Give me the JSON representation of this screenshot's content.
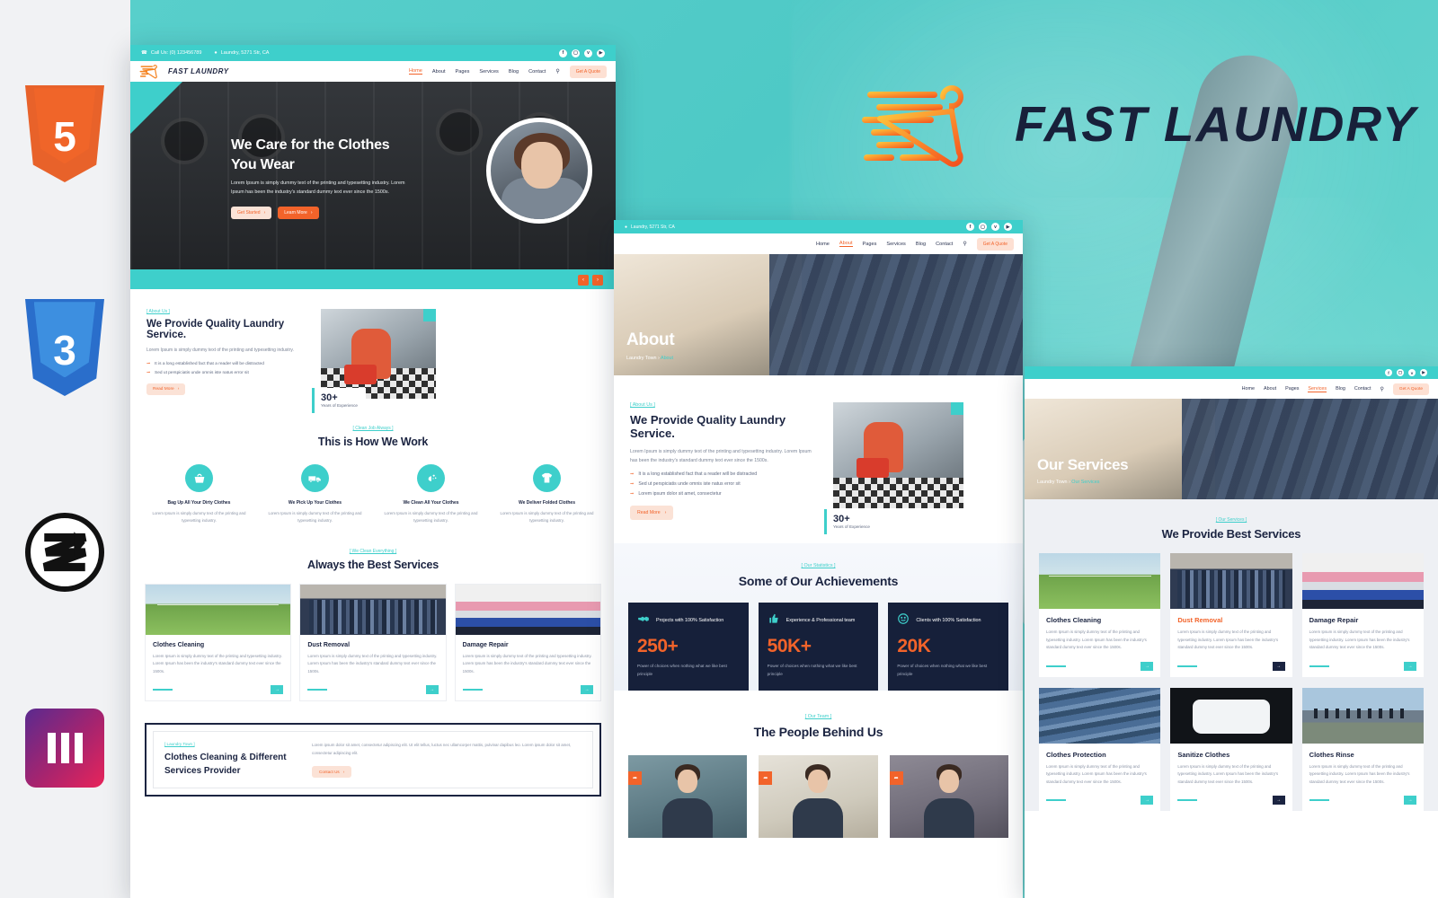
{
  "brand": {
    "name": "FAST LAUNDRY",
    "logo_icon": "hanger-speed-icon"
  },
  "banner": {
    "title": "FAST LAUNDRY"
  },
  "tech_badges": [
    {
      "name": "html5-badge",
      "label": "5"
    },
    {
      "name": "css3-badge",
      "label": "3"
    },
    {
      "name": "zend-badge",
      "label": ""
    },
    {
      "name": "elementor-badge",
      "label": ""
    }
  ],
  "topbar": {
    "phone_icon": "phone-icon",
    "phone": "Call Us: (0) 123456789",
    "location_icon": "map-pin-icon",
    "location": "Laundry, 5271 Str, CA",
    "socials": [
      {
        "name": "facebook-icon",
        "glyph": "f"
      },
      {
        "name": "instagram-icon",
        "glyph": "▢"
      },
      {
        "name": "twitter-icon",
        "glyph": "ᴠ"
      },
      {
        "name": "youtube-icon",
        "glyph": "▶"
      }
    ]
  },
  "nav": {
    "items": [
      "Home",
      "About",
      "Pages",
      "Services",
      "Blog",
      "Contact"
    ],
    "search_icon": "search-icon",
    "quote_label": "Get A Quote",
    "quote_arrow": "›",
    "active_home": "Home",
    "active_about": "About",
    "active_services": "Services"
  },
  "home": {
    "hero": {
      "title": "We Care for the Clothes You Wear",
      "paragraph": "Lorem Ipsum is simply dummy text of the printing and typesetting industry. Lorem Ipsum has been the industry's standard dummy text ever since the 1500s.",
      "btn_primary": "Get Started",
      "btn_secondary": "Learn More",
      "prev_icon": "chevron-left-icon",
      "next_icon": "chevron-right-icon"
    },
    "about": {
      "eyebrow": "[ About Us ]",
      "title": "We Provide Quality Laundry Service.",
      "paragraph": "Lorem Ipsum is simply dummy text of the printing and typesetting industry.",
      "bullets": [
        "It is a long established fact that a reader will be distracted",
        "Sed ut perspiciatis unde omnis iste natus error sit"
      ],
      "read_more": "Read More",
      "exp_number": "30+",
      "exp_label": "Years of Experience"
    },
    "work": {
      "eyebrow": "[ Clean Job Always ]",
      "title": "This is How We Work",
      "steps": [
        {
          "icon": "basket-icon",
          "title": "Bag Up All Your Dirty Clothes",
          "text": "Lorem Ipsum is simply dummy text of the printing and typesetting industry."
        },
        {
          "icon": "truck-icon",
          "title": "We Pick Up Your Clothes",
          "text": "Lorem Ipsum is simply dummy text of the printing and typesetting industry."
        },
        {
          "icon": "washing-hand-icon",
          "title": "We Clean All Your Clothes",
          "text": "Lorem Ipsum is simply dummy text of the printing and typesetting industry."
        },
        {
          "icon": "tshirt-icon",
          "title": "We Deliver Folded Clothes",
          "text": "Lorem Ipsum is simply dummy text of the printing and typesetting industry."
        }
      ]
    },
    "services": {
      "eyebrow": "[ We Clean Everything ]",
      "title": "Always the Best Services",
      "cards": [
        {
          "title": "Clothes Cleaning",
          "text": "Lorem Ipsum is simply dummy text of the printing and typesetting industry. Lorem Ipsum has been the industry's standard dummy text ever since the 1500s."
        },
        {
          "title": "Dust Removal",
          "text": "Lorem Ipsum is simply dummy text of the printing and typesetting industry. Lorem Ipsum has been the industry's standard dummy text ever since the 1500s."
        },
        {
          "title": "Damage Repair",
          "text": "Lorem Ipsum is simply dummy text of the printing and typesetting industry. Lorem Ipsum has been the industry's standard dummy text ever since the 1500s."
        }
      ]
    },
    "cta": {
      "eyebrow": "[ Laundry Town ]",
      "title": "Clothes Cleaning & Different Services Provider",
      "text": "Lorem ipsum dolor sit amet, consectetur adipiscing elit. Ut elit tellus, luctus nec ullamcorper mattis, pulvinar dapibus leo. Lorem ipsum dolor sit amet, consectetur adipiscing elit.",
      "button": "Contact Us"
    }
  },
  "about_page": {
    "hero_title": "About",
    "crumb_root": "Laundry Town",
    "crumb_sep": "›",
    "crumb_current": "About",
    "about": {
      "eyebrow": "[ About Us ]",
      "title": "We Provide Quality Laundry Service.",
      "paragraph": "Lorem Ipsum is simply dummy text of the printing and typesetting industry. Lorem Ipsum has been the industry's standard dummy text ever since the 1500s.",
      "bullets": [
        "It is a long established fact that a reader will be distracted",
        "Sed ut perspiciatis unde omnis iste natus error sit",
        "Lorem ipsum dolor sit amet, consectetur"
      ],
      "read_more": "Read More",
      "exp_number": "30+",
      "exp_label": "Years of Experience"
    },
    "stats": {
      "eyebrow": "[ Our Statistics ]",
      "title": "Some of Our Achievements",
      "items": [
        {
          "icon": "handshake-icon",
          "label": "Projects with 100% Satisfaction",
          "value": "250+",
          "sub": "Power of choices when nothing what we like best principle"
        },
        {
          "icon": "thumbs-up-icon",
          "label": "Experience & Professional team",
          "value": "50K+",
          "sub": "Power of choices when nothing what we like best principle"
        },
        {
          "icon": "smiley-icon",
          "label": "Clients with 100% Satisfaction",
          "value": "20K",
          "sub": "Power of choices when nothing what we like best principle"
        }
      ]
    },
    "team": {
      "eyebrow": "[ Our Team ]",
      "title": "The People Behind Us",
      "share_icon": "share-icon"
    }
  },
  "services_page": {
    "hero_title": "Our Services",
    "crumb_root": "Laundry Town",
    "crumb_sep": "›",
    "crumb_current": "Our Services",
    "eyebrow": "[ Our Services ]",
    "title": "We Provide Best Services",
    "cards": [
      {
        "title": "Clothes Cleaning",
        "text": "Lorem Ipsum is simply dummy text of the printing and typesetting industry. Lorem Ipsum has been the industry's standard dummy text ever since the 1500s.",
        "highlight": false
      },
      {
        "title": "Dust Removal",
        "text": "Lorem Ipsum is simply dummy text of the printing and typesetting industry. Lorem Ipsum has been the industry's standard dummy text ever since the 1500s.",
        "highlight": true
      },
      {
        "title": "Damage Repair",
        "text": "Lorem Ipsum is simply dummy text of the printing and typesetting industry. Lorem Ipsum has been the industry's standard dummy text ever since the 1500s.",
        "highlight": false
      },
      {
        "title": "Clothes Protection",
        "text": "Lorem Ipsum is simply dummy text of the printing and typesetting industry. Lorem Ipsum has been the industry's standard dummy text ever since the 1500s.",
        "highlight": false
      },
      {
        "title": "Sanitize Clothes",
        "text": "Lorem Ipsum is simply dummy text of the printing and typesetting industry. Lorem Ipsum has been the industry's standard dummy text ever since the 1500s.",
        "highlight": false
      },
      {
        "title": "Clothes Rinse",
        "text": "Lorem Ipsum is simply dummy text of the printing and typesetting industry. Lorem Ipsum has been the industry's standard dummy text ever since the 1500s.",
        "highlight": false
      }
    ],
    "card_arrow": "→"
  },
  "colors": {
    "teal": "#3ecfcb",
    "orange": "#f2632a",
    "navy": "#16203a",
    "peach": "#fbe2d6"
  }
}
